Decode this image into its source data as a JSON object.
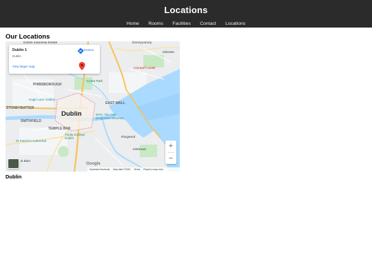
{
  "header": {
    "title": "Locations",
    "nav": [
      "Home",
      "Rooms",
      "Facilities",
      "Contact",
      "Locations"
    ]
  },
  "main": {
    "section_title": "Our Locations",
    "map_caption": "Dublin"
  },
  "map": {
    "card": {
      "place": "Dublin 1",
      "address": "Dublin",
      "directions": "Directions",
      "view_larger": "View larger map"
    },
    "labels": {
      "dublin_industrial_estate": "Dublin Industrial Estate",
      "donnycarney": "Donnycarney",
      "killester": "Killester",
      "phibsborough": "PHIBSBOROUGH",
      "croke_park": "Croke Park",
      "clontarf_castle": "Clontarf Castle",
      "high_lane_gallery": "Hugh Lane Gallery",
      "stoneybatter": "STONEYBATTER",
      "east_wall": "EAST WALL",
      "dublin": "Dublin",
      "smithfield": "SMITHFIELD",
      "epic": "EPIC The Irish Emigration Museum",
      "temple_bar": "TEMPLE BAR",
      "trinity": "Trinity College Dublin",
      "ringsend": "Ringsend",
      "st_patricks": "St Patrick's Cathedral",
      "irishtown": "Irishtown",
      "bain": "& Bain"
    },
    "zoom_in": "+",
    "zoom_out": "−",
    "google": "Google",
    "attribution": [
      "Keyboard shortcuts",
      "Map data ©2024",
      "Terms",
      "Report a map error"
    ]
  },
  "colors": {
    "header_bg": "#2b2b2b",
    "map_water": "#aadaff",
    "map_road_major": "#f6c454",
    "map_park": "#c9e8c4",
    "card_link": "#1a73e8"
  },
  "icons": [
    "directions-icon",
    "location-pin-icon",
    "thumbnail-satellite-icon"
  ]
}
